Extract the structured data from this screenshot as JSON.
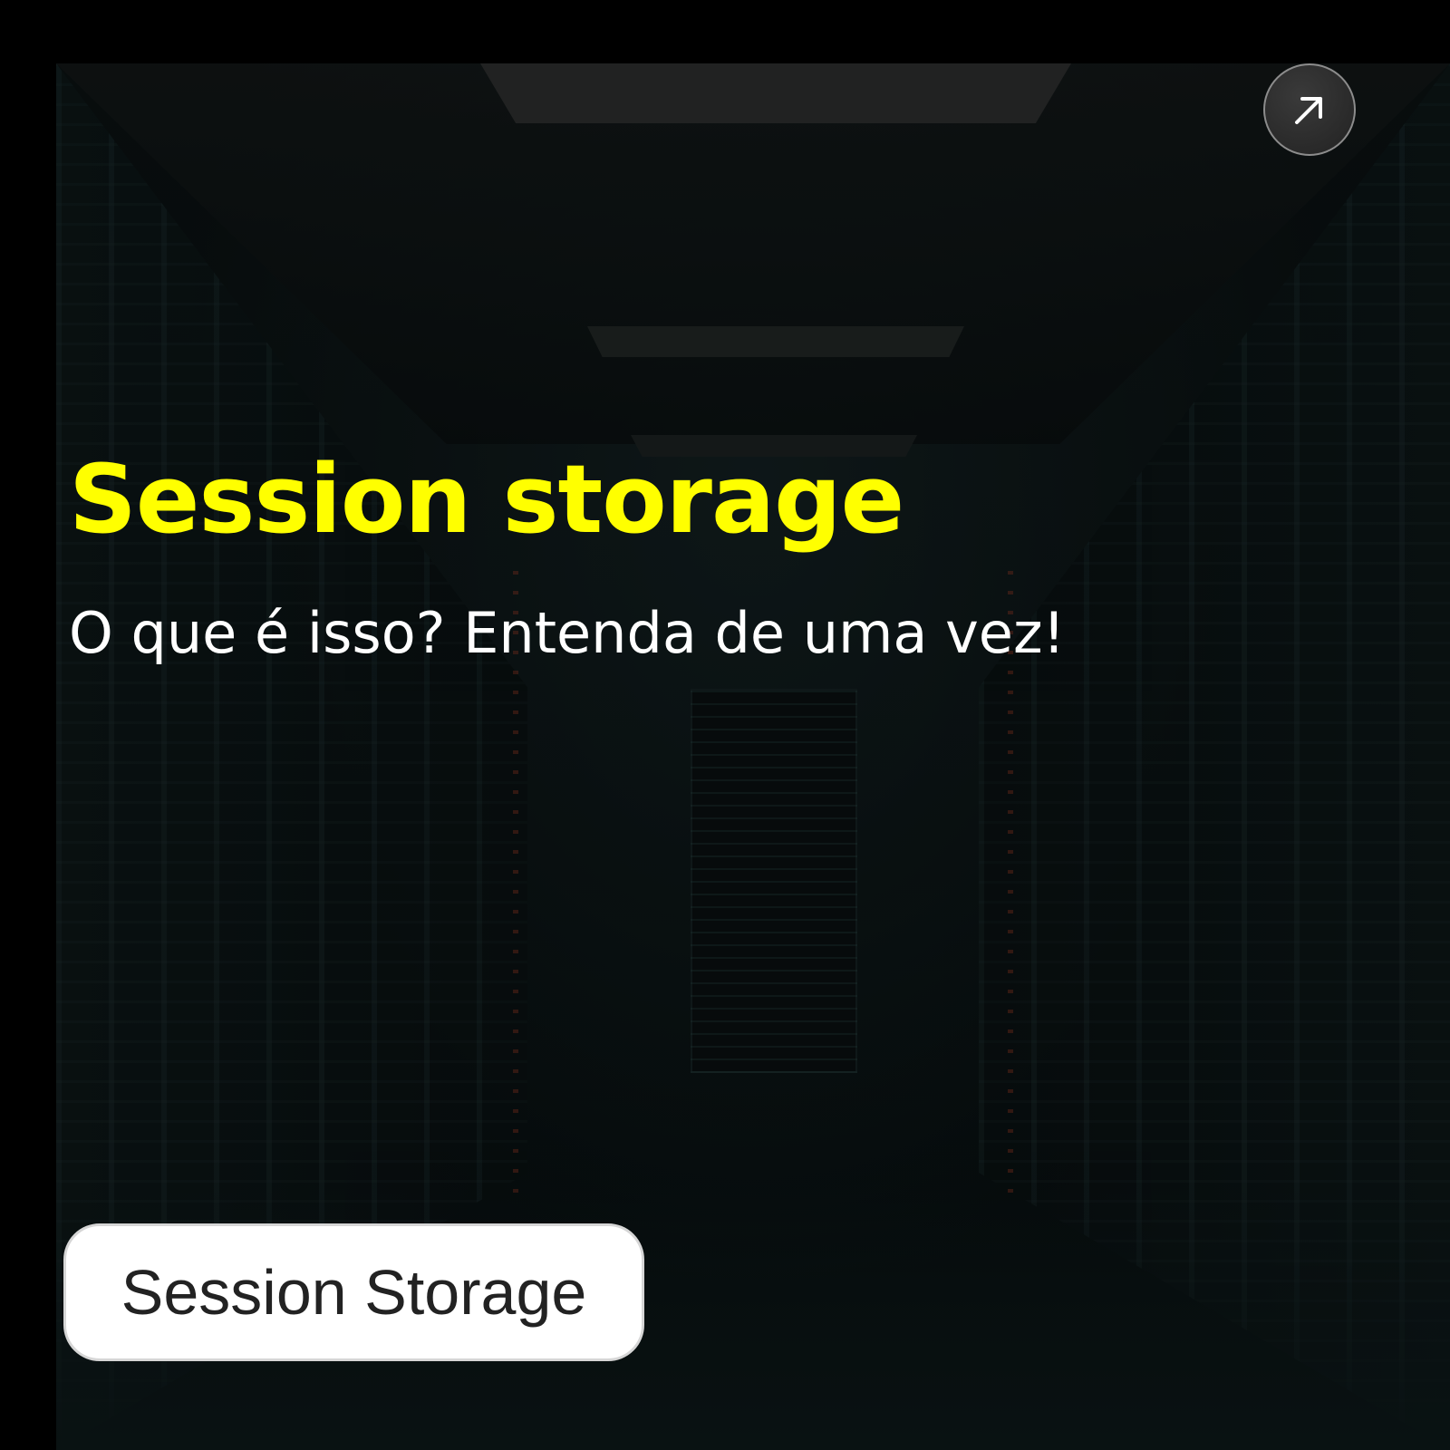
{
  "hero": {
    "title": "Session storage",
    "subtitle": "O que é isso? Entenda de uma vez!"
  },
  "open_button": {
    "icon": "arrow-up-right-icon"
  },
  "tag": {
    "label": "Session Storage"
  },
  "colors": {
    "title": "#ffff00",
    "subtitle": "#ffffff",
    "page_background": "#000000",
    "tag_background": "#ffffff",
    "tag_text": "#222222"
  }
}
